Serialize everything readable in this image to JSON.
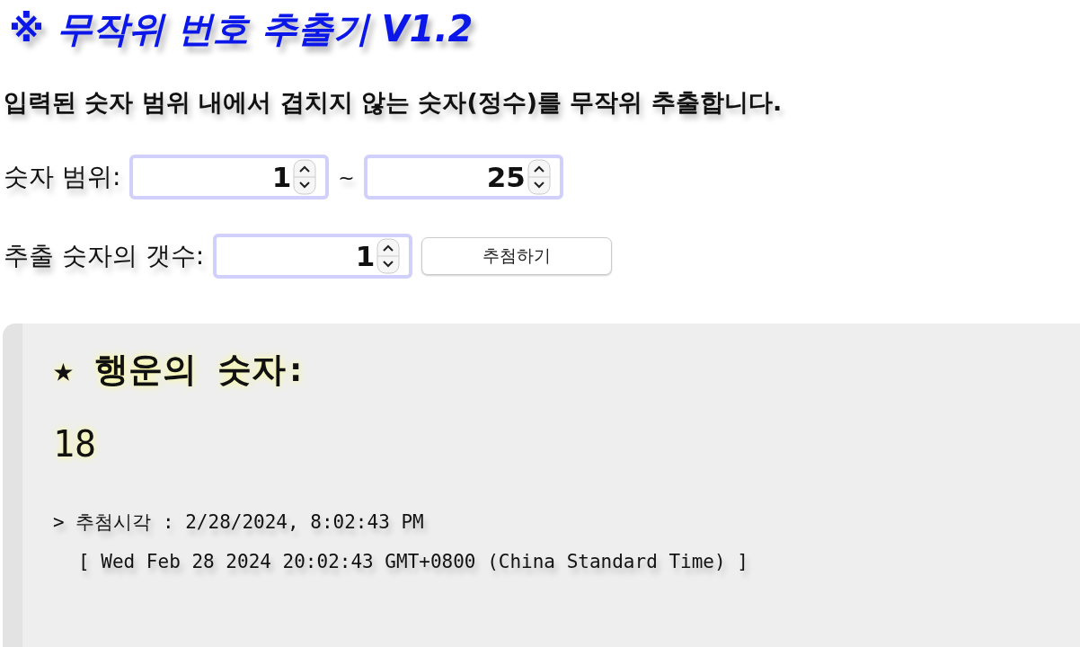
{
  "title": "※ 무작위 번호 추출기 V1.2",
  "description": "입력된 숫자 범위 내에서 겹치지 않는 숫자(정수)를 무작위 추출합니다.",
  "range": {
    "label": "숫자 범위:",
    "from": "1",
    "separator": "~",
    "to": "25"
  },
  "count": {
    "label": "추출 숫자의 갯수:",
    "value": "1",
    "button": "추첨하기"
  },
  "result": {
    "heading": "★ 행운의 숫자:",
    "numbers": "18",
    "time_line": "> 추첨시각 : 2/28/2024, 8:02:43 PM",
    "full_time": "[ Wed Feb 28 2024 20:02:43 GMT+0800 (China Standard Time) ]"
  }
}
